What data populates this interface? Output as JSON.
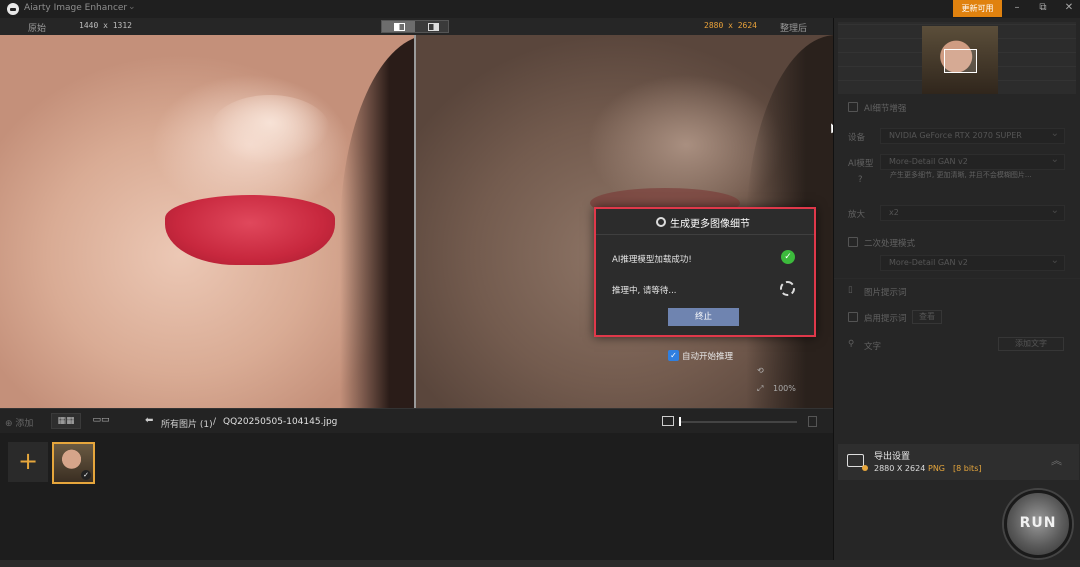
{
  "window": {
    "title": "Aiarty Image Enhancer",
    "update_label": "更新可用",
    "min_icon": "–",
    "max_icon": "⧉",
    "close_icon": "✕"
  },
  "compare": {
    "original_label": "原始",
    "original_size": "1440 x 1312",
    "output_size": "2880 x 2624",
    "processed_label": "整理后",
    "zoom_level": "100%"
  },
  "dialog": {
    "title": "生成更多图像细节",
    "status_loaded": "AI推理模型加载成功!",
    "status_running": "推理中, 请等待...",
    "stop_label": "终止"
  },
  "auto_infer": {
    "label": "自动开始推理",
    "checked": true
  },
  "file_bar": {
    "add_label": "添加",
    "breadcrumb_all": "所有图片 (1)",
    "breadcrumb_sep": "/",
    "file_name": "QQ20250505-104145.jpg"
  },
  "right_panel": {
    "ai_detail_label": "AI细节增强",
    "device_label": "设备",
    "device_value": "NVIDIA GeForce RTX 2070 SUPER",
    "model_label": "AI模型",
    "model_value": "More-Detail GAN v2",
    "model_hint": "产生更多细节, 更加清晰, 并且不会模糊图片...",
    "scale_label": "放大",
    "scale_value": "x2",
    "second_model_label": "二次处理模式",
    "second_model_value": "More-Detail GAN v2",
    "prompt_section": "图片提示词",
    "prompt_check_label": "启用提示词",
    "prompt_btn": "查看",
    "text_label": "文字",
    "text_btn": "添加文字"
  },
  "export": {
    "title": "导出设置",
    "dimensions": "2880 X 2624",
    "format": "PNG",
    "bits": "[8 bits]"
  },
  "run_label": "RUN"
}
